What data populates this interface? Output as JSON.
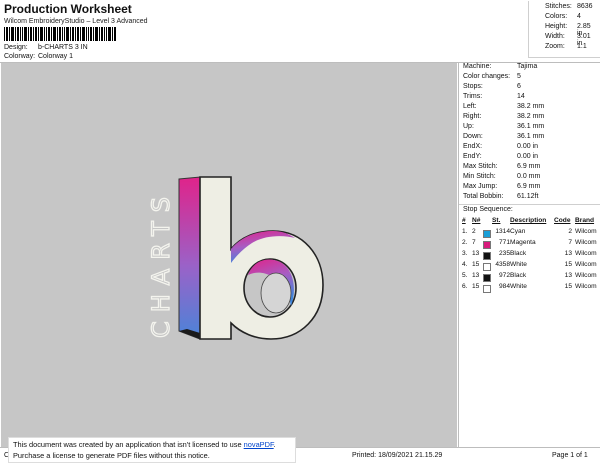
{
  "header": {
    "title": "Production Worksheet",
    "subtitle": "Wilcom EmbroideryStudio – Level 3 Advanced",
    "design_label": "Design:",
    "design_value": "b-CHARTS 3 IN",
    "colorway_label": "Colorway:",
    "colorway_value": "Colorway 1"
  },
  "stats": [
    {
      "label": "Stitches:",
      "value": "8636"
    },
    {
      "label": "Colors:",
      "value": "4"
    },
    {
      "label": "Height:",
      "value": "2.85 in"
    },
    {
      "label": "Width:",
      "value": "3.01 in"
    },
    {
      "label": "Zoom:",
      "value": "1:1"
    }
  ],
  "machine_info": [
    {
      "label": "Machine:",
      "value": "Tajima"
    },
    {
      "label": "Color changes:",
      "value": "5"
    },
    {
      "label": "Stops:",
      "value": "6"
    },
    {
      "label": "Trims:",
      "value": "14"
    },
    {
      "label": "Left:",
      "value": "38.2 mm"
    },
    {
      "label": "Right:",
      "value": "38.2 mm"
    },
    {
      "label": "Up:",
      "value": "36.1 mm"
    },
    {
      "label": "Down:",
      "value": "36.1 mm"
    },
    {
      "label": "EndX:",
      "value": "0.00 in"
    },
    {
      "label": "EndY:",
      "value": "0.00 in"
    },
    {
      "label": "Max Stitch:",
      "value": "6.9 mm"
    },
    {
      "label": "Min Stitch:",
      "value": "0.0 mm"
    },
    {
      "label": "Max Jump:",
      "value": "6.9 mm"
    },
    {
      "label": "Total Bobbin:",
      "value": "61.12ft"
    }
  ],
  "stop_sequence": {
    "title": "Stop Sequence:",
    "headers": [
      "#",
      "N#",
      "St.",
      "Description",
      "Code",
      "Brand"
    ],
    "rows": [
      {
        "idx": "1.",
        "n": "2",
        "color": "#1a9fd8",
        "st": "1314",
        "desc": "Cyan",
        "code": "2",
        "brand": "Wilcom"
      },
      {
        "idx": "2.",
        "n": "7",
        "color": "#d81b7c",
        "st": "771",
        "desc": "Magenta",
        "code": "7",
        "brand": "Wilcom"
      },
      {
        "idx": "3.",
        "n": "13",
        "color": "#111111",
        "st": "235",
        "desc": "Black",
        "code": "13",
        "brand": "Wilcom"
      },
      {
        "idx": "4.",
        "n": "15",
        "color": "#ffffff",
        "st": "4358",
        "desc": "White",
        "code": "15",
        "brand": "Wilcom"
      },
      {
        "idx": "5.",
        "n": "13",
        "color": "#111111",
        "st": "972",
        "desc": "Black",
        "code": "13",
        "brand": "Wilcom"
      },
      {
        "idx": "6.",
        "n": "15",
        "color": "#ffffff",
        "st": "984",
        "desc": "White",
        "code": "15",
        "brand": "Wilcom"
      }
    ]
  },
  "design_preview": {
    "logo_text": "CHARTS",
    "letter": "b"
  },
  "footer": {
    "left": "Cr",
    "printed": "Printed: 18/09/2021 21.15.29",
    "page": "Page 1 of 1"
  },
  "notice": {
    "line1_pre": "This document was created by an application that isn't licensed to use ",
    "link": "novaPDF",
    "line1_post": ".",
    "line2": "Purchase a license to generate PDF files without this notice."
  },
  "colors": {
    "background_panel": "#c6c6c6",
    "cyan": "#1a9fd8",
    "magenta": "#d81b7c"
  }
}
